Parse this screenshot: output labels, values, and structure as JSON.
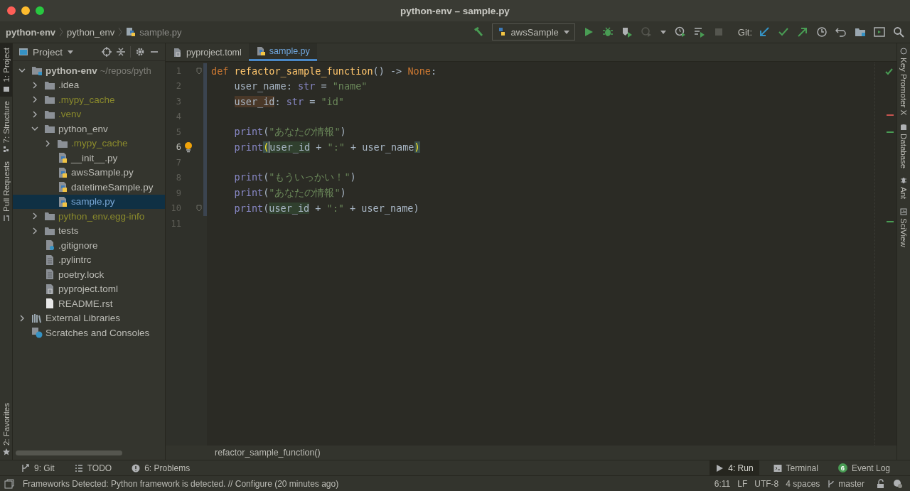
{
  "window": {
    "title": "python-env – sample.py"
  },
  "breadcrumbs": [
    {
      "label": "python-env",
      "kind": "project"
    },
    {
      "label": "python_env",
      "kind": "folder"
    },
    {
      "label": "sample.py",
      "kind": "python"
    }
  ],
  "toolbar": {
    "run_config": "awsSample",
    "git_label": "Git:"
  },
  "left_stripe": [
    {
      "label": "1: Project",
      "selected": true,
      "kind": "project"
    },
    {
      "label": "7: Structure",
      "selected": false,
      "kind": "structure"
    },
    {
      "label": "Pull Requests",
      "selected": false,
      "kind": "pull"
    }
  ],
  "favorites": {
    "label": "2: Favorites"
  },
  "project_panel": {
    "title": "Project",
    "tree": [
      {
        "label": "python-env",
        "path": "~/repos/pyth",
        "kind": "module",
        "expanded": true,
        "selected": false,
        "excluded": false,
        "children": [
          {
            "label": ".idea",
            "kind": "folder",
            "expanded": false,
            "selected": false,
            "excluded": false
          },
          {
            "label": ".mypy_cache",
            "kind": "folder",
            "expanded": false,
            "selected": false,
            "excluded": true
          },
          {
            "label": ".venv",
            "kind": "folder",
            "expanded": false,
            "selected": false,
            "excluded": true
          },
          {
            "label": "python_env",
            "kind": "folder",
            "expanded": true,
            "selected": false,
            "excluded": false,
            "children": [
              {
                "label": ".mypy_cache",
                "kind": "folder",
                "expanded": false,
                "selected": false,
                "excluded": true
              },
              {
                "label": "__init__.py",
                "kind": "python",
                "selected": false,
                "excluded": false
              },
              {
                "label": "awsSample.py",
                "kind": "python",
                "selected": false,
                "excluded": false
              },
              {
                "label": "datetimeSample.py",
                "kind": "python",
                "selected": false,
                "excluded": false
              },
              {
                "label": "sample.py",
                "kind": "python",
                "selected": true,
                "excluded": false
              }
            ]
          },
          {
            "label": "python_env.egg-info",
            "kind": "folder",
            "expanded": false,
            "selected": false,
            "excluded": true
          },
          {
            "label": "tests",
            "kind": "folder",
            "expanded": false,
            "selected": false,
            "excluded": false
          },
          {
            "label": ".gitignore",
            "kind": "gitignore",
            "selected": false,
            "excluded": false
          },
          {
            "label": ".pylintrc",
            "kind": "file",
            "selected": false,
            "excluded": false
          },
          {
            "label": "poetry.lock",
            "kind": "file",
            "selected": false,
            "excluded": false
          },
          {
            "label": "pyproject.toml",
            "kind": "toml",
            "selected": false,
            "excluded": false
          },
          {
            "label": "README.rst",
            "kind": "text",
            "selected": false,
            "excluded": false
          }
        ]
      },
      {
        "label": "External Libraries",
        "kind": "libraries",
        "expanded": false,
        "selected": false,
        "excluded": false
      },
      {
        "label": "Scratches and Consoles",
        "kind": "scratches",
        "selected": false,
        "excluded": false
      }
    ]
  },
  "tabs": [
    {
      "label": "pyproject.toml",
      "kind": "toml",
      "selected": false
    },
    {
      "label": "sample.py",
      "kind": "python",
      "selected": true
    }
  ],
  "editor": {
    "lines": [
      {
        "number": "1",
        "current": false,
        "changed": true,
        "fold": true,
        "indent": false,
        "tokens": [
          {
            "kind": "keyword",
            "text": "def "
          },
          {
            "kind": "function",
            "text": "refactor_sample_function"
          },
          {
            "kind": "plain",
            "text": "() -> "
          },
          {
            "kind": "keyword",
            "text": "None"
          },
          {
            "kind": "plain",
            "text": ":"
          }
        ]
      },
      {
        "number": "2",
        "current": false,
        "changed": true,
        "indent": true,
        "tokens": [
          {
            "kind": "plain",
            "text": "user_name: "
          },
          {
            "kind": "builtin",
            "text": "str"
          },
          {
            "kind": "plain",
            "text": " = "
          },
          {
            "kind": "string",
            "text": "\"name\""
          }
        ]
      },
      {
        "number": "3",
        "current": false,
        "changed": true,
        "indent": true,
        "tokens": [
          {
            "kind": "warning",
            "text": "user_id"
          },
          {
            "kind": "plain",
            "text": ": "
          },
          {
            "kind": "builtin",
            "text": "str"
          },
          {
            "kind": "plain",
            "text": " = "
          },
          {
            "kind": "string",
            "text": "\"id\""
          }
        ]
      },
      {
        "number": "4",
        "current": false,
        "changed": true
      },
      {
        "number": "5",
        "current": false,
        "changed": true,
        "indent": true,
        "tokens": [
          {
            "kind": "builtin",
            "text": "print"
          },
          {
            "kind": "plain",
            "text": "("
          },
          {
            "kind": "string",
            "text": "\"あなたの情報\""
          },
          {
            "kind": "plain",
            "text": ")"
          }
        ]
      },
      {
        "number": "6",
        "current": true,
        "changed": true,
        "indent": true,
        "tokens": [
          {
            "kind": "builtin",
            "text": "print"
          },
          {
            "kind": "brace",
            "text": "("
          },
          {
            "kind": "usage",
            "text": "user_id",
            "caret": true
          },
          {
            "kind": "plain",
            "text": " + "
          },
          {
            "kind": "string",
            "text": "\":\""
          },
          {
            "kind": "plain",
            "text": " + user_name"
          },
          {
            "kind": "brace",
            "text": ")"
          }
        ]
      },
      {
        "number": "7",
        "current": false,
        "changed": true
      },
      {
        "number": "8",
        "current": false,
        "changed": true,
        "indent": true,
        "tokens": [
          {
            "kind": "builtin",
            "text": "print"
          },
          {
            "kind": "plain",
            "text": "("
          },
          {
            "kind": "string",
            "text": "\"もういっかい！\""
          },
          {
            "kind": "plain",
            "text": ")"
          }
        ]
      },
      {
        "number": "9",
        "current": false,
        "changed": true,
        "indent": true,
        "tokens": [
          {
            "kind": "builtin",
            "text": "print"
          },
          {
            "kind": "plain",
            "text": "("
          },
          {
            "kind": "string",
            "text": "\"あなたの情報\""
          },
          {
            "kind": "plain",
            "text": ")"
          }
        ]
      },
      {
        "number": "10",
        "current": false,
        "changed": true,
        "fold": true,
        "indent": true,
        "tokens": [
          {
            "kind": "builtin",
            "text": "print"
          },
          {
            "kind": "plain",
            "text": "("
          },
          {
            "kind": "usage",
            "text": "user_id"
          },
          {
            "kind": "plain",
            "text": " + "
          },
          {
            "kind": "string",
            "text": "\":\""
          },
          {
            "kind": "plain",
            "text": " + user_name)"
          }
        ]
      },
      {
        "number": "11",
        "current": false
      }
    ],
    "breadcrumb": "refactor_sample_function()"
  },
  "right_stripe": [
    {
      "label": "Key Promoter X",
      "kind": "key"
    },
    {
      "label": "Database",
      "kind": "database"
    },
    {
      "label": "Ant",
      "kind": "ant"
    },
    {
      "label": "SciView",
      "kind": "sciview"
    }
  ],
  "bottom_tools": {
    "left": [
      {
        "label": "9: Git",
        "kind": "git",
        "selected": false
      },
      {
        "label": "TODO",
        "kind": "todo",
        "selected": false
      },
      {
        "label": "6: Problems",
        "kind": "problems",
        "selected": false
      }
    ],
    "right": [
      {
        "label": "4: Run",
        "kind": "run",
        "selected": true
      },
      {
        "label": "Terminal",
        "kind": "terminal",
        "selected": false
      },
      {
        "label": "Event Log",
        "kind": "log",
        "selected": false,
        "badge": "6"
      }
    ]
  },
  "status_bar": {
    "message": "Frameworks Detected: Python framework is detected. // Configure (20 minutes ago)",
    "items": [
      "6:11",
      "LF",
      "UTF-8",
      "4 spaces"
    ],
    "branch": "master"
  }
}
